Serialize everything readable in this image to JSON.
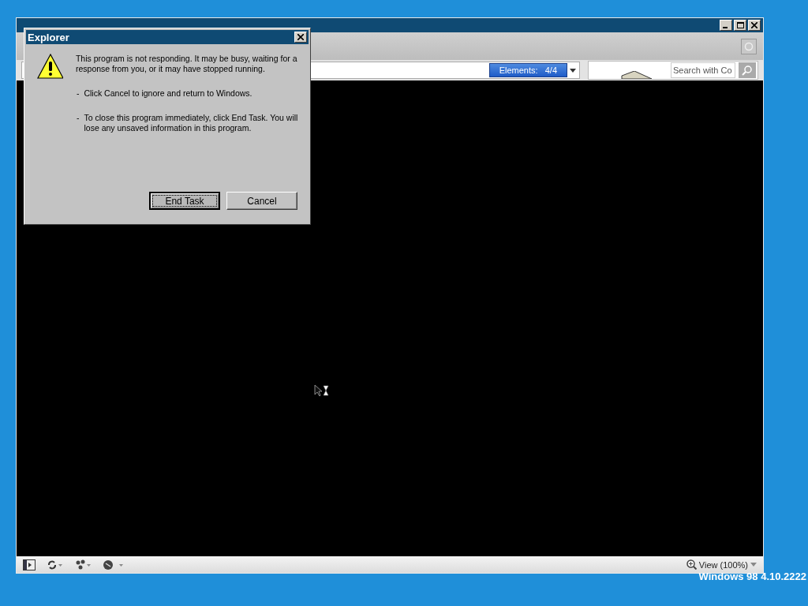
{
  "browser": {
    "address_bar": {
      "elements_badge": "Elements:   4/4"
    },
    "search": {
      "placeholder": "Search with Co"
    },
    "status_bar": {
      "zoom": "View (100%)"
    }
  },
  "dialog": {
    "title": "Explorer",
    "message": "This program is not responding. It may be busy, waiting for a response from you, or it may have stopped running.",
    "bullets": [
      {
        "dash": "-",
        "text": "Click Cancel to ignore and return to Windows."
      },
      {
        "dash": "-",
        "text": "To close this program immediately, click End Task. You will lose any unsaved information in this program."
      }
    ],
    "buttons": [
      {
        "label": "End Task",
        "focused": true
      },
      {
        "label": "Cancel",
        "focused": false
      }
    ]
  },
  "desktop": {
    "version": "Windows 98 4.10.2222"
  }
}
